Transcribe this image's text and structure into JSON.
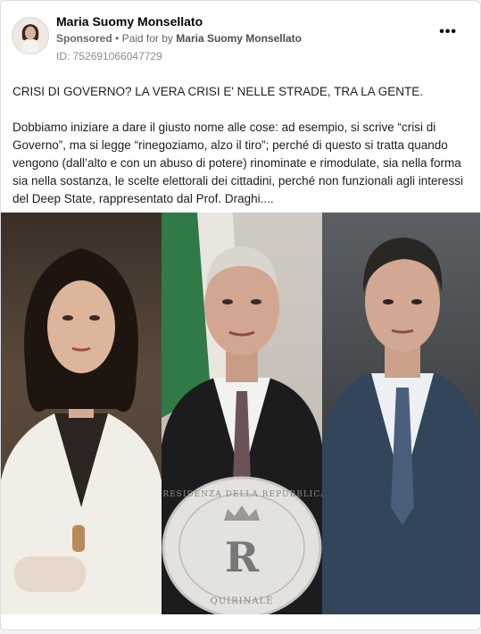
{
  "post": {
    "author": "Maria Suomy Monsellato",
    "sponsored_label": "Sponsored",
    "separator": "•",
    "paid_for_prefix": "Paid for by",
    "paid_for_by": "Maria Suomy Monsellato",
    "ad_id": "ID: 752691066047729",
    "more_icon": "more-horizontal-icon",
    "headline": "CRISI DI GOVERNO? LA VERA CRISI E' NELLE STRADE, TRA LA GENTE.",
    "body": "Dobbiamo iniziare a dare il giusto nome alle cose: ad esempio, si scrive “crisi di Governo”, ma si legge “rinegoziamo, alzo il tiro”; perché di questo si tratta quando vengono (dall’alto e con un abuso di potere) rinominate e rimodulate, sia nella forma sia nella sostanza, le scelte elettorali dei cittadini, perché non funzionali agli interessi del Deep State, rappresentato dal Prof. Draghi...."
  },
  "media": {
    "seal_text_top": "PRESIDENZA DELLA REPUBBLICA",
    "seal_text_bottom": "QUIRINALE",
    "seal_monogram": "R"
  },
  "colors": {
    "card_bg": "#ffffff",
    "page_bg": "#f0f2f5",
    "text_primary": "#050505",
    "text_secondary": "#65676b"
  }
}
